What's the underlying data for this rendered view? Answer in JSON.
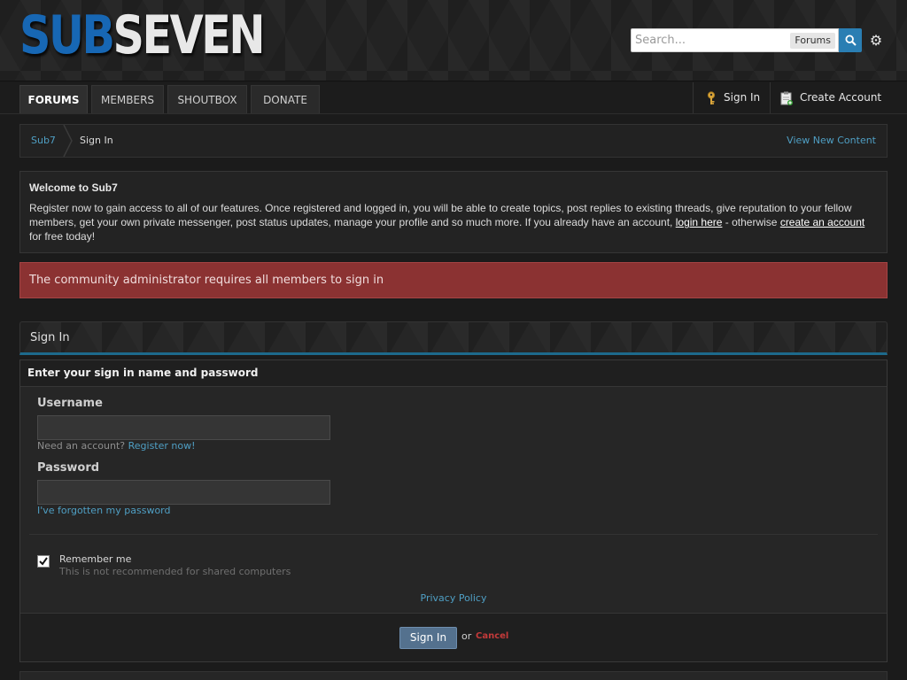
{
  "header": {
    "logo_part1": "SUB",
    "logo_part2": "SEVEN",
    "search_placeholder": "Search...",
    "search_scope": "Forums",
    "search_icon": "search-icon",
    "settings_icon": "gear-icon"
  },
  "nav": {
    "tabs": [
      {
        "label": "FORUMS",
        "active": true
      },
      {
        "label": "MEMBERS",
        "active": false
      },
      {
        "label": "SHOUTBOX",
        "active": false
      },
      {
        "label": "DONATE",
        "active": false
      }
    ],
    "sign_in": "Sign In",
    "create_account": "Create Account"
  },
  "breadcrumb": {
    "home": "Sub7",
    "current": "Sign In",
    "view_new": "View New Content"
  },
  "welcome": {
    "title": "Welcome to Sub7",
    "text_before": "Register now to gain access to all of our features. Once registered and logged in, you will be able to create topics, post replies to existing threads, give reputation to your fellow members, get your own private messenger, post status updates, manage your profile and so much more. If you already have an account, ",
    "login_link": "login here",
    "text_middle": " - otherwise ",
    "create_link": "create an account",
    "text_after": " for free today!"
  },
  "alert": {
    "message": "The community administrator requires all members to sign in"
  },
  "signin": {
    "panel_title": "Sign In",
    "form_header": "Enter your sign in name and password",
    "username_label": "Username",
    "username_value": "",
    "need_account": "Need an account? ",
    "register_link": "Register now!",
    "password_label": "Password",
    "password_value": "",
    "forgot_link": "I've forgotten my password",
    "remember_label": "Remember me",
    "remember_checked": true,
    "remember_sub": "This is not recommended for shared computers",
    "privacy": "Privacy Policy",
    "submit": "Sign In",
    "or": "or",
    "cancel": "Cancel"
  },
  "colors": {
    "accent": "#2a7eb3",
    "link": "#4f9fc4",
    "alert_bg": "#8b3232",
    "logo_blue": "#1767b4",
    "cancel": "#c43a3a"
  }
}
